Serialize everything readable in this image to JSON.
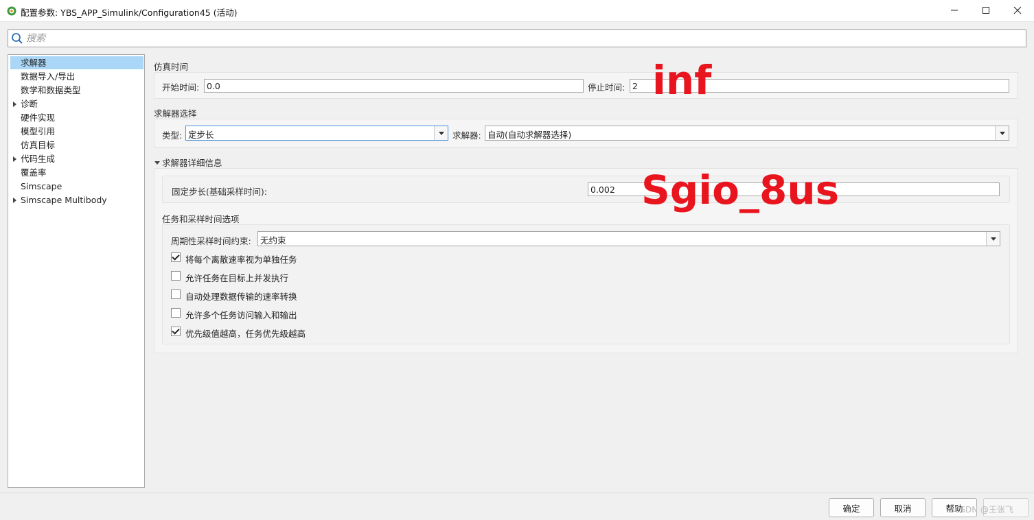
{
  "window": {
    "title": "配置参数: YBS_APP_Simulink/Configuration45 (活动)"
  },
  "search": {
    "placeholder": "搜索"
  },
  "sidebar": {
    "items": [
      {
        "label": "求解器"
      },
      {
        "label": "数据导入/导出"
      },
      {
        "label": "数学和数据类型"
      },
      {
        "label": "诊断"
      },
      {
        "label": "硬件实现"
      },
      {
        "label": "模型引用"
      },
      {
        "label": "仿真目标"
      },
      {
        "label": "代码生成"
      },
      {
        "label": "覆盖率"
      },
      {
        "label": "Simscape"
      },
      {
        "label": "Simscape Multibody"
      }
    ]
  },
  "sim_time": {
    "section": "仿真时间",
    "start_label": "开始时间:",
    "start_value": "0.0",
    "stop_label": "停止时间:",
    "stop_value": "2"
  },
  "solver_select": {
    "section": "求解器选择",
    "type_label": "类型:",
    "type_value": "定步长",
    "solver_label": "求解器:",
    "solver_value": "自动(自动求解器选择)"
  },
  "solver_details": {
    "section": "求解器详细信息",
    "step_label": "固定步长(基础采样时间):",
    "step_value": "0.002"
  },
  "tasking": {
    "section": "任务和采样时间选项",
    "periodic_label": "周期性采样时间约束:",
    "periodic_value": "无约束",
    "options": [
      {
        "label": "将每个离散速率视为单独任务",
        "checked": true
      },
      {
        "label": "允许任务在目标上并发执行",
        "checked": false
      },
      {
        "label": "自动处理数据传输的速率转换",
        "checked": false
      },
      {
        "label": "允许多个任务访问输入和输出",
        "checked": false
      },
      {
        "label": "优先级值越高，任务优先级越高",
        "checked": true
      }
    ]
  },
  "annotations": {
    "inf": "inf",
    "sgio": "Sgio_8us"
  },
  "footer": {
    "ok": "确定",
    "cancel": "取消",
    "help": "帮助",
    "watermark": "CSDN @王张飞"
  },
  "colors": {
    "selection": "#aad7f8",
    "annotation": "#e8141e"
  }
}
